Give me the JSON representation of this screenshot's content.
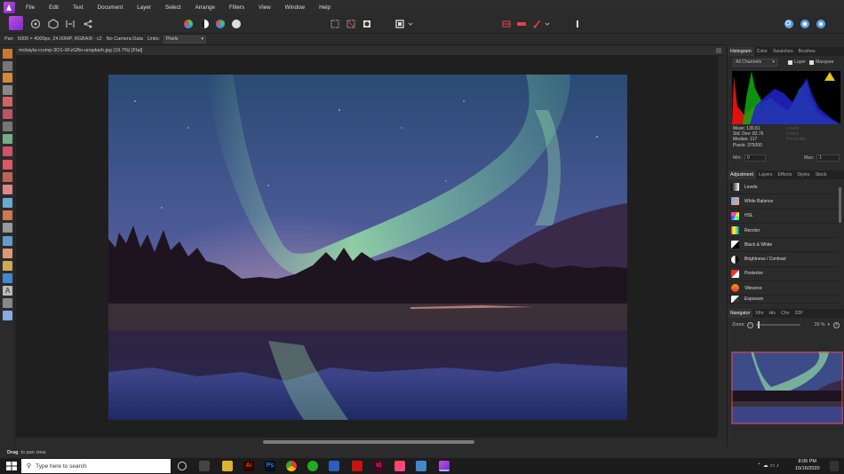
{
  "menubar": {
    "items": [
      "File",
      "Edit",
      "Text",
      "Document",
      "Layer",
      "Select",
      "Arrange",
      "Filters",
      "View",
      "Window",
      "Help"
    ]
  },
  "toolbar": {
    "icons": [
      "persona-photo-icon",
      "persona-liquify-icon",
      "persona-develop-icon",
      "persona-tone-map-icon",
      "persona-export-icon",
      "auto-levels-icon",
      "auto-contrast-icon",
      "auto-colors-icon",
      "auto-white-balance-icon",
      "selection-icon",
      "no-selection-icon",
      "quick-mask-icon",
      "snapping-icon",
      "assistant-icon",
      "hide-selection-icon",
      "order-icon",
      "view-mode-icon",
      "zoom-icon",
      "studio-link-icon",
      "more-icon"
    ]
  },
  "contextbar": {
    "tool": "Pan",
    "info": "6000 × 4000px, 24.00MP, RGBA/8 - c2",
    "camera": "No Camera Data",
    "units_label": "Units:",
    "units_value": "Pixels"
  },
  "document": {
    "tab_title": "mckayla-crump-3O1-XFzGBo-unsplash.jpg (19.7%) [Flat]"
  },
  "status": {
    "bold": "Drag",
    "text": "to pan view."
  },
  "histogram": {
    "tabs": [
      "Histogram",
      "Color",
      "Swatches",
      "Brushes"
    ],
    "channel": "All Channels",
    "layer_label": "Layer",
    "marquee_label": "Marquee",
    "stats": [
      "Mean: 130.81",
      "Std. Dev: 82.76",
      "Median: 117",
      "Pixels: 375000"
    ],
    "stats_dim": [
      "Levels",
      "Count",
      "Percentile"
    ],
    "min_label": "Min:",
    "min_value": "0",
    "max_label": "Max:",
    "max_value": "1"
  },
  "adjustment": {
    "tabs": [
      "Adjustment",
      "Layers",
      "Effects",
      "Styles",
      "Stock"
    ],
    "items": [
      "Levels",
      "White Balance",
      "HSL",
      "Recolor",
      "Black & White",
      "Brightness / Contrast",
      "Posterize",
      "Vibrance",
      "Exposure"
    ]
  },
  "navigator": {
    "tabs": [
      "Navigator",
      "Xfm",
      "His",
      "Chn",
      "32P"
    ],
    "zoom_label": "Zoom:",
    "zoom_value": "20 %"
  },
  "taskbar": {
    "search_placeholder": "Type here to search",
    "time": "8:06 PM",
    "date": "10/16/2020"
  }
}
